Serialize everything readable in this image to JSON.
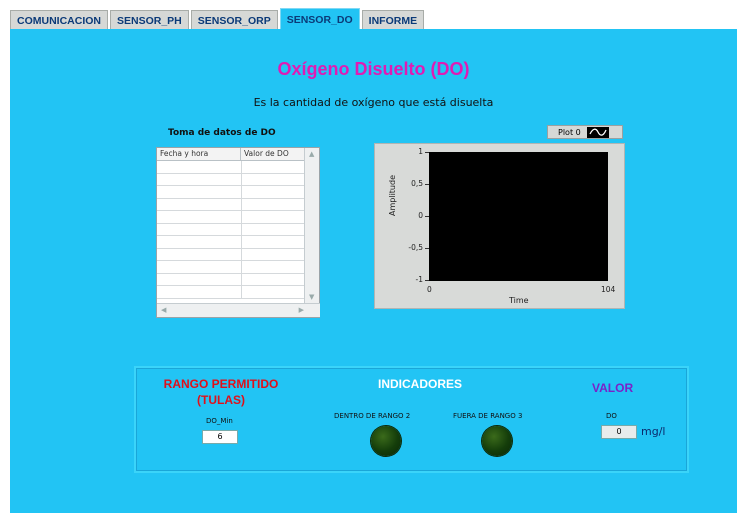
{
  "tabs": [
    "COMUNICACION",
    "SENSOR_PH",
    "SENSOR_ORP",
    "SENSOR_DO",
    "INFORME"
  ],
  "active_tab": "SENSOR_DO",
  "title": "Oxígeno Disuelto (DO)",
  "subtitle": "Es la cantidad de oxígeno que está disuelta",
  "table": {
    "caption": "Toma de datos de DO",
    "headers": [
      "Fecha y hora",
      "Valor de DO"
    ]
  },
  "graph": {
    "legend_label": "Plot 0",
    "ylabel": "Amplitude",
    "xlabel": "Time",
    "y_ticks": [
      "1",
      "0,5",
      "0",
      "-0,5",
      "-1"
    ],
    "x_ticks": [
      "0",
      "104"
    ]
  },
  "rango": {
    "title_line1": "RANGO PERMITIDO",
    "title_line2": "(TULAS)",
    "do_min_label": "DO_Min",
    "do_min_value": "6"
  },
  "indicadores": {
    "title": "INDICADORES",
    "led1_label": "DENTRO DE RANGO 2",
    "led2_label": "FUERA DE RANGO 3"
  },
  "valor": {
    "title": "VALOR",
    "do_label": "DO",
    "do_value": "0",
    "unit": "mg/l"
  },
  "colors": {
    "panel_bg": "#22c4f4",
    "title": "#e01bb4",
    "rango": "#e0101a",
    "valor": "#7a22c8",
    "led_off": "#1f4d0e"
  }
}
